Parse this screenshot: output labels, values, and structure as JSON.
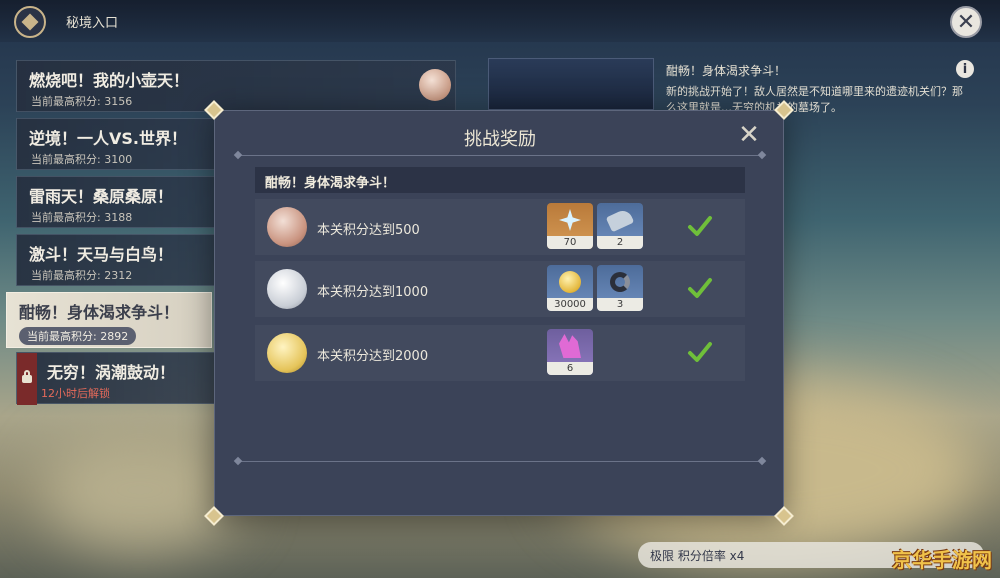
{
  "header": {
    "title": "秘境入口"
  },
  "levels": [
    {
      "name": "燃烧吧！我的小壶天！",
      "score": "当前最高积分: 3156"
    },
    {
      "name": "逆境！一人VS.世界！",
      "score": "当前最高积分: 3100"
    },
    {
      "name": "雷雨天！桑原桑原！",
      "score": "当前最高积分: 3188"
    },
    {
      "name": "激斗！天马与白鸟！",
      "score": "当前最高积分: 2312"
    },
    {
      "name": "酣畅！身体渴求争斗！",
      "score": "当前最高积分: 2892"
    },
    {
      "name": "无穷！涡潮鼓动！",
      "score": "12小时后解锁"
    }
  ],
  "detail": {
    "title": "酣畅！身体渴求争斗！",
    "description": "新的挑战开始了！敌人居然是不知道哪里来的遗迹机关们？那么这里就是…无穷的机关的墓场了。"
  },
  "modal": {
    "title": "挑战奖励",
    "section": "酣畅！身体渴求争斗！",
    "rewards": [
      {
        "label": "本关积分达到500",
        "items": [
          {
            "icon": "primogem-icon",
            "qty": "70"
          },
          {
            "icon": "gauntlet-icon",
            "qty": "2"
          }
        ]
      },
      {
        "label": "本关积分达到1000",
        "items": [
          {
            "icon": "mora-coin-icon",
            "qty": "30000"
          },
          {
            "icon": "swirl-material-icon",
            "qty": "3"
          }
        ]
      },
      {
        "label": "本关积分达到2000",
        "items": [
          {
            "icon": "crystal-icon",
            "qty": "6"
          }
        ]
      }
    ]
  },
  "footer": {
    "multiplier": "极限 积分倍率 x4"
  },
  "watermark": "京华手游网",
  "colors": {
    "accent_gold": "#d8c48e",
    "check_green": "#6fbf3a",
    "locked_red": "#e56a5a"
  }
}
